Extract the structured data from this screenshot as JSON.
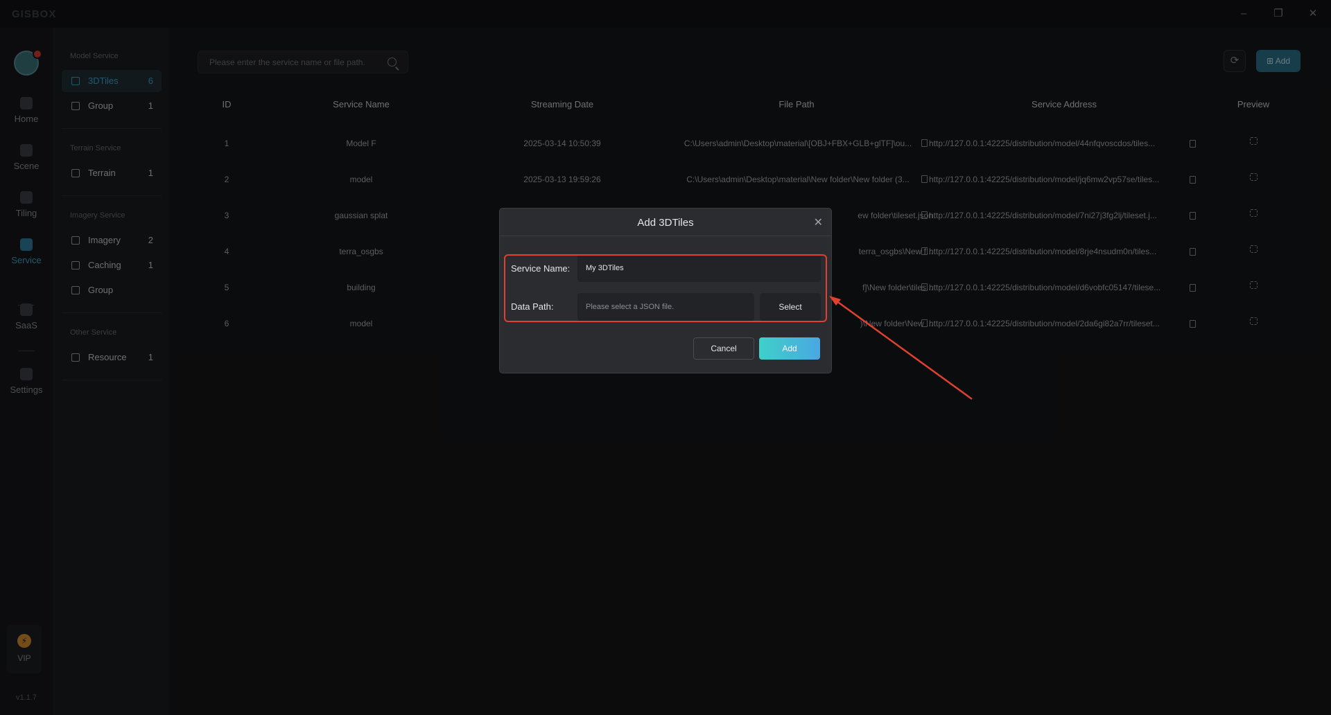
{
  "app": {
    "logo": "GISBOX"
  },
  "window": {
    "minimize": "–",
    "restore": "❐",
    "close": "✕"
  },
  "rail": {
    "items": [
      {
        "label": "Home",
        "icon": "home-icon"
      },
      {
        "label": "Scene",
        "icon": "scene-icon"
      },
      {
        "label": "Tiling",
        "icon": "tiling-icon"
      },
      {
        "label": "Service",
        "icon": "service-icon"
      },
      {
        "label": "SaaS",
        "icon": "saas-icon"
      },
      {
        "label": "Settings",
        "icon": "settings-icon"
      }
    ],
    "active": "Service",
    "vip": "VIP",
    "version": "v1.1.7"
  },
  "subnav": {
    "sections": [
      {
        "title": "Model Service",
        "items": [
          {
            "label": "3DTiles",
            "count": "6"
          },
          {
            "label": "Group",
            "count": "1"
          }
        ]
      },
      {
        "title": "Terrain Service",
        "items": [
          {
            "label": "Terrain",
            "count": "1"
          }
        ]
      },
      {
        "title": "Imagery Service",
        "items": [
          {
            "label": "Imagery",
            "count": "2"
          },
          {
            "label": "Caching",
            "count": "1"
          },
          {
            "label": "Group",
            "count": ""
          }
        ]
      },
      {
        "title": "Other Service",
        "items": [
          {
            "label": "Resource",
            "count": "1"
          }
        ]
      }
    ]
  },
  "toolbar": {
    "search_placeholder": "Please enter the service name or file path.",
    "refresh_icon": "⟳",
    "add_label": "Add"
  },
  "table": {
    "headers": [
      "ID",
      "Service Name",
      "Streaming Date",
      "File Path",
      "Service Address",
      "Preview"
    ],
    "rows": [
      {
        "id": "1",
        "name": "Model F",
        "date": "2025-03-14 10:50:39",
        "path": "C:\\Users\\admin\\Desktop\\material\\[OBJ+FBX+GLB+glTF]\\ou...",
        "address": "http://127.0.0.1:42225/distribution/model/44nfqvoscdos/tiles..."
      },
      {
        "id": "2",
        "name": "model",
        "date": "2025-03-13 19:59:26",
        "path": "C:\\Users\\admin\\Desktop\\material\\New folder\\New folder (3...",
        "address": "http://127.0.0.1:42225/distribution/model/jq6mw2vp57se/tiles..."
      },
      {
        "id": "3",
        "name": "gaussian splat",
        "date": "",
        "path": "ew folder\\tileset.json",
        "address": "http://127.0.0.1:42225/distribution/model/7ni27j3fg2lj/tileset.j..."
      },
      {
        "id": "4",
        "name": "terra_osgbs",
        "date": "",
        "path": "terra_osgbs\\New f...",
        "address": "http://127.0.0.1:42225/distribution/model/8rje4nsudm0n/tiles..."
      },
      {
        "id": "5",
        "name": "building",
        "date": "",
        "path": "f]\\New folder\\tiles...",
        "address": "http://127.0.0.1:42225/distribution/model/d6vobfc05147/tilese..."
      },
      {
        "id": "6",
        "name": "model",
        "date": "",
        "path": ")\\New folder\\New ...",
        "address": "http://127.0.0.1:42225/distribution/model/2da6gi82a7rr/tileset..."
      }
    ]
  },
  "dialog": {
    "title": "Add 3DTiles",
    "close_icon": "✕",
    "service_name_label": "Service Name:",
    "service_name_value": "My 3DTiles",
    "data_path_label": "Data Path:",
    "data_path_placeholder": "Please select a JSON file.",
    "select_label": "Select",
    "cancel_label": "Cancel",
    "add_label": "Add"
  },
  "colors": {
    "accent": "#3aa2c7",
    "highlight": "#e2402e"
  }
}
